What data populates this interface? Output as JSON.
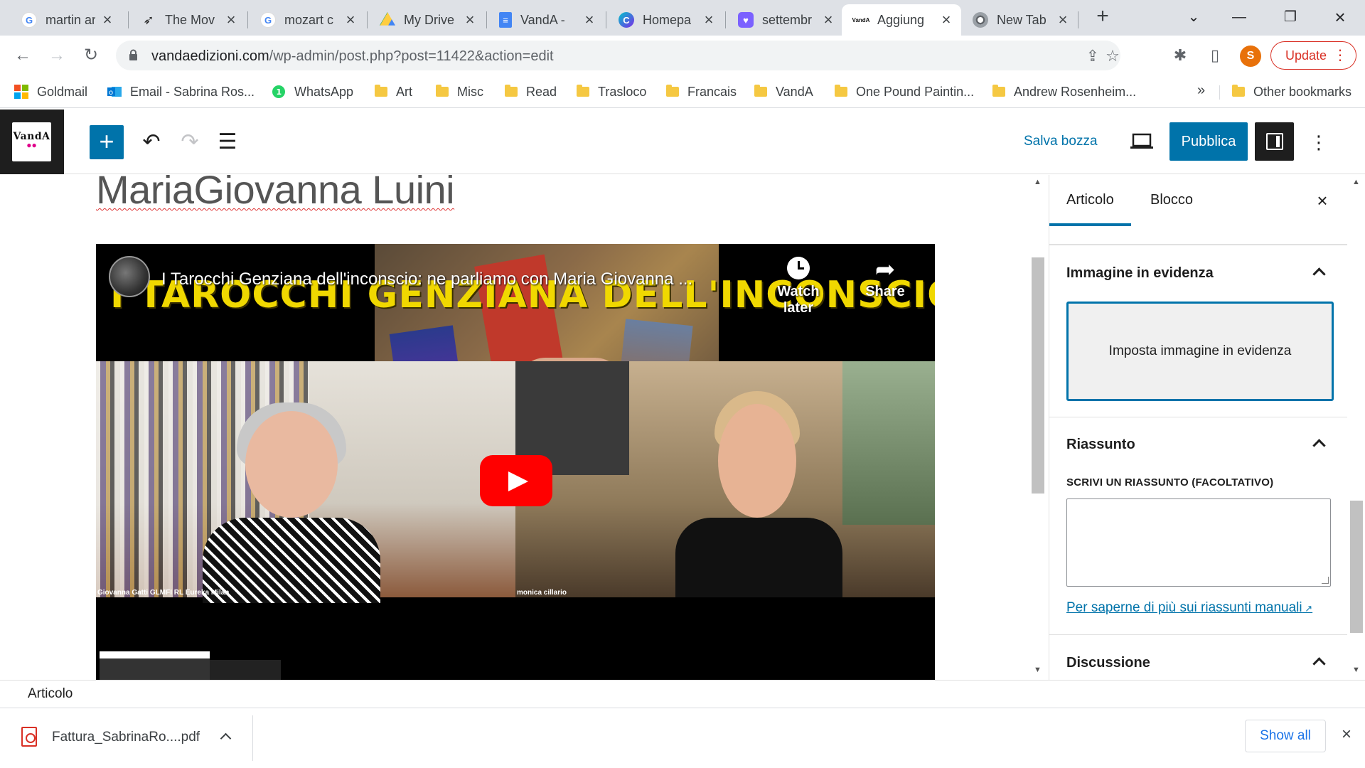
{
  "browser": {
    "tabs": [
      {
        "label": "martin ar",
        "icon": "google-icon"
      },
      {
        "label": "The Mov",
        "icon": "bird-icon"
      },
      {
        "label": "mozart c",
        "icon": "google-icon"
      },
      {
        "label": "My Drive",
        "icon": "drive-icon"
      },
      {
        "label": "VandA -",
        "icon": "docs-icon"
      },
      {
        "label": "Homepa",
        "icon": "canva-icon"
      },
      {
        "label": "settembr",
        "icon": "heart-icon"
      },
      {
        "label": "Aggiung",
        "icon": "vanda-icon",
        "active": true
      },
      {
        "label": "New Tab",
        "icon": "chrome-icon"
      }
    ],
    "url_host": "vandaedizioni.com",
    "url_path": "/wp-admin/post.php?post=11422&action=edit",
    "profile_initial": "S",
    "update_label": "Update",
    "bookmarks": [
      {
        "label": "Goldmail",
        "icon": "microsoft-icon"
      },
      {
        "label": "Email - Sabrina Ros...",
        "icon": "outlook-icon"
      },
      {
        "label": "WhatsApp",
        "icon": "whatsapp-icon"
      },
      {
        "label": "Art",
        "icon": "folder-icon"
      },
      {
        "label": "Misc",
        "icon": "folder-icon"
      },
      {
        "label": "Read",
        "icon": "folder-icon"
      },
      {
        "label": "Trasloco",
        "icon": "folder-icon"
      },
      {
        "label": "Francais",
        "icon": "folder-icon"
      },
      {
        "label": "VandA",
        "icon": "folder-icon"
      },
      {
        "label": "One Pound Paintin...",
        "icon": "folder-icon"
      },
      {
        "label": "Andrew Rosenheim...",
        "icon": "folder-icon"
      }
    ],
    "bookmarks_overflow": "»",
    "other_bookmarks": "Other bookmarks"
  },
  "wp": {
    "logo_text": "VandA",
    "save_draft": "Salva bozza",
    "publish": "Pubblica",
    "title_fragment": "MariaGiovanna Luini",
    "video": {
      "title": "I Tarocchi Genziana dell'inconscio: ne parliamo con Maria Giovanna ...",
      "headline": "I TAROCCHI GENZIANA DELL'INCONSCIO",
      "watch_later": "Watch later",
      "share": "Share",
      "caption_left": "Giovanna Gatti GLMFI RL Eureka Milan",
      "caption_right": "monica cillario"
    },
    "sidebar": {
      "tab_post": "Articolo",
      "tab_block": "Blocco",
      "featured_image_heading": "Immagine in evidenza",
      "featured_image_button": "Imposta immagine in evidenza",
      "excerpt_heading": "Riassunto",
      "excerpt_label": "SCRIVI UN RIASSUNTO (FACOLTATIVO)",
      "excerpt_value": "",
      "excerpt_link": "Per saperne di più sui riassunti manuali",
      "discussion_heading": "Discussione"
    },
    "breadcrumb": "Articolo"
  },
  "downloads": {
    "file_name": "Fattura_SabrinaRo....pdf",
    "show_all": "Show all"
  },
  "colors": {
    "wp_blue": "#0073aa",
    "chrome_tab_bg": "#dee1e6",
    "update_red": "#d93025"
  }
}
